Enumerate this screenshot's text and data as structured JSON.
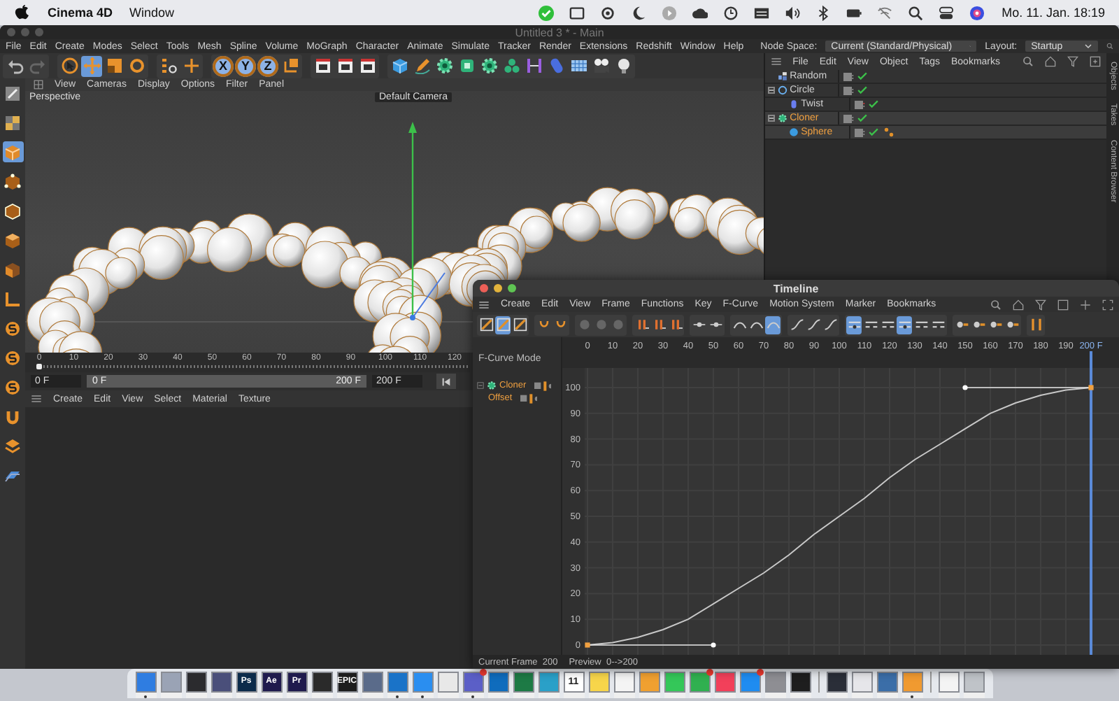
{
  "menubar": {
    "app": "Cinema 4D",
    "menus": [
      "Window"
    ],
    "clock": "Mo. 11. Jan. 18:19"
  },
  "window": {
    "title": "Untitled 3 * - Main",
    "menus": [
      "File",
      "Edit",
      "Create",
      "Modes",
      "Select",
      "Tools",
      "Mesh",
      "Spline",
      "Volume",
      "MoGraph",
      "Character",
      "Animate",
      "Simulate",
      "Tracker",
      "Render",
      "Extensions",
      "Redshift",
      "Window",
      "Help"
    ],
    "node_space": {
      "label": "Node Space:",
      "value": "Current (Standard/Physical)"
    },
    "layout": {
      "label": "Layout:",
      "value": "Startup"
    }
  },
  "toolbar": [
    [
      {
        "kind": "undo",
        "selected": false
      },
      {
        "kind": "redo",
        "selected": false
      }
    ],
    [
      {
        "kind": "select",
        "selected": false
      },
      {
        "kind": "move",
        "selected": true
      },
      {
        "kind": "scale",
        "selected": false
      },
      {
        "kind": "rotate",
        "selected": false
      }
    ],
    [
      {
        "kind": "recent",
        "selected": false
      },
      {
        "kind": "axis",
        "selected": false
      }
    ],
    [
      {
        "kind": "letter",
        "label": "X",
        "selected": true
      },
      {
        "kind": "letter",
        "label": "Y",
        "selected": true
      },
      {
        "kind": "letter",
        "label": "Z",
        "selected": true
      },
      {
        "kind": "coord",
        "selected": false
      }
    ],
    [
      {
        "kind": "clapper",
        "selected": false
      },
      {
        "kind": "clapper",
        "selected": false
      },
      {
        "kind": "clapper",
        "selected": false
      }
    ],
    [
      {
        "kind": "cube",
        "selected": false
      },
      {
        "kind": "pen",
        "selected": false
      },
      {
        "kind": "gear",
        "selected": false
      },
      {
        "kind": "greencube",
        "selected": false
      },
      {
        "kind": "gear",
        "selected": false
      },
      {
        "kind": "cluster",
        "selected": false
      },
      {
        "kind": "deformer",
        "selected": false
      },
      {
        "kind": "capsule",
        "selected": false
      },
      {
        "kind": "grid",
        "selected": false
      },
      {
        "kind": "camera",
        "selected": false
      },
      {
        "kind": "bulb",
        "selected": false
      }
    ]
  ],
  "tool_strip": [
    {
      "kind": "edit",
      "selected": false
    },
    {
      "kind": "checker",
      "selected": false
    },
    {
      "kind": "cube",
      "selected": true
    },
    {
      "kind": "points",
      "selected": false
    },
    {
      "kind": "edges",
      "selected": false
    },
    {
      "kind": "polygons",
      "selected": false
    },
    {
      "kind": "uv",
      "selected": false
    },
    {
      "kind": "axis",
      "selected": false
    },
    {
      "kind": "snap",
      "selected": false
    },
    {
      "kind": "snap",
      "selected": false
    },
    {
      "kind": "snap",
      "selected": false
    },
    {
      "kind": "magnet",
      "selected": false
    },
    {
      "kind": "layers",
      "selected": false
    },
    {
      "kind": "plane",
      "selected": false
    }
  ],
  "viewport": {
    "menus": [
      "View",
      "Cameras",
      "Display",
      "Options",
      "Filter",
      "Panel"
    ],
    "view_name": "Perspective",
    "camera": "Default Camera"
  },
  "powerslider": {
    "ticks": [
      "0",
      "10",
      "20",
      "30",
      "40",
      "50",
      "60",
      "70",
      "80",
      "90",
      "100",
      "110",
      "120"
    ],
    "start": "0 F",
    "range": {
      "start": "0 F",
      "end": "200 F",
      "level": 1
    },
    "end": "200 F"
  },
  "material_manager": {
    "menus": [
      "Create",
      "Edit",
      "View",
      "Select",
      "Material",
      "Texture"
    ]
  },
  "objects": {
    "menus": [
      "File",
      "Edit",
      "View",
      "Object",
      "Tags",
      "Bookmarks"
    ],
    "tree": [
      {
        "name": "Random",
        "kind": "effector",
        "selected": false,
        "disabled": false
      },
      {
        "name": "Circle",
        "kind": "spline",
        "selected": false,
        "expanded": true,
        "disabled": false,
        "children": [
          {
            "name": "Twist",
            "kind": "deformer",
            "selected": false,
            "disabled": true
          }
        ]
      },
      {
        "name": "Cloner",
        "kind": "cloner",
        "selected": true,
        "expanded": true,
        "disabled": false,
        "children": [
          {
            "name": "Sphere",
            "kind": "sphere",
            "selected": true,
            "disabled": false,
            "tags": [
              {
                "kind": "phong"
              }
            ]
          }
        ]
      }
    ],
    "side_tabs": [
      "Objects",
      "Takes",
      "Content Browser"
    ]
  },
  "timeline": {
    "title": "Timeline",
    "menus": [
      "Create",
      "Edit",
      "View",
      "Frame",
      "Functions",
      "Key",
      "F-Curve",
      "Motion System",
      "Marker",
      "Bookmarks"
    ],
    "toolbar": [
      [
        {
          "selected": false
        },
        {
          "selected": true
        },
        {
          "selected": false
        }
      ],
      [
        {
          "selected": false
        },
        {
          "selected": false
        }
      ],
      [
        {
          "selected": false
        },
        {
          "selected": false
        },
        {
          "selected": false
        }
      ],
      [
        {
          "selected": false
        },
        {
          "selected": false
        },
        {
          "selected": false
        }
      ],
      [
        {
          "selected": false
        },
        {
          "selected": false
        }
      ],
      [
        {
          "selected": false
        },
        {
          "selected": false
        },
        {
          "selected": true
        }
      ],
      [
        {
          "selected": false
        },
        {
          "selected": false
        },
        {
          "selected": false
        }
      ],
      [
        {
          "selected": true
        },
        {
          "selected": false
        },
        {
          "selected": false
        },
        {
          "selected": true
        },
        {
          "selected": false
        },
        {
          "selected": false
        }
      ],
      [
        {
          "selected": false
        },
        {
          "selected": false
        },
        {
          "selected": false
        },
        {
          "selected": false
        }
      ],
      [
        {
          "selected": false
        }
      ]
    ],
    "mode": "F-Curve Mode",
    "tracks": [
      {
        "name": "Cloner",
        "selected": true,
        "expanded": true,
        "children": [
          {
            "name": "Offset",
            "selected": true
          }
        ]
      }
    ],
    "chart_data": {
      "type": "line",
      "x": [
        0,
        10,
        20,
        30,
        40,
        50,
        60,
        70,
        80,
        90,
        100,
        110,
        120,
        130,
        140,
        150,
        160,
        170,
        180,
        190,
        200
      ],
      "series": [
        {
          "color": "#c8c8c8",
          "values": [
            0,
            1,
            3,
            6,
            10,
            16,
            22,
            28,
            35,
            43,
            50,
            57,
            65,
            72,
            78,
            84,
            90,
            94,
            97,
            99,
            100
          ]
        }
      ],
      "xlim": [
        0,
        200
      ],
      "ylim": [
        0,
        100
      ],
      "grid": true,
      "xticks": [
        0,
        10,
        20,
        30,
        40,
        50,
        60,
        70,
        80,
        90,
        100,
        110,
        120,
        130,
        140,
        150,
        160,
        170,
        180,
        190,
        {
          "value": 200,
          "label": "200 F"
        }
      ],
      "yticks": [
        0,
        10,
        20,
        30,
        40,
        50,
        60,
        70,
        80,
        90,
        100
      ]
    },
    "status": [
      "Current Frame  200",
      "Preview  0-->200"
    ]
  },
  "dock": {
    "apps": [
      {
        "kind": "app",
        "color": "#2f7de1",
        "running": true,
        "badge": false
      },
      {
        "kind": "app",
        "color": "#9aa3b5",
        "running": false,
        "badge": false
      },
      {
        "kind": "app",
        "color": "#2b2b2e",
        "running": false,
        "badge": false
      },
      {
        "kind": "app",
        "color": "#4a4f7a",
        "running": false,
        "badge": false
      },
      {
        "kind": "labeled",
        "label": "Ps",
        "color": "#0b2a4a",
        "running": false,
        "badge": false
      },
      {
        "kind": "labeled",
        "label": "Ae",
        "color": "#1f1a4d",
        "running": false,
        "badge": false
      },
      {
        "kind": "labeled",
        "label": "Pr",
        "color": "#1f1a4d",
        "running": false,
        "badge": false
      },
      {
        "kind": "app",
        "color": "#2a2a2a",
        "running": false,
        "badge": false
      },
      {
        "kind": "labeled",
        "label": "EPIC",
        "color": "#1d1d1d",
        "running": false,
        "badge": false
      },
      {
        "kind": "app",
        "color": "#5a6b8a",
        "running": false,
        "badge": false
      },
      {
        "kind": "app",
        "color": "#1a73c8",
        "running": true,
        "badge": false
      },
      {
        "kind": "app",
        "color": "#2a8ef0",
        "running": true,
        "badge": false
      },
      {
        "kind": "app",
        "color": "#e8e8e8",
        "running": false,
        "badge": false
      },
      {
        "kind": "app",
        "color": "#5b5fc7",
        "running": true,
        "badge": true
      },
      {
        "kind": "app",
        "color": "#0f6cbd",
        "running": false,
        "badge": false
      },
      {
        "kind": "app",
        "color": "#1d7a45",
        "running": false,
        "badge": false
      },
      {
        "kind": "app",
        "color": "#2aa0c8",
        "running": false,
        "badge": false
      },
      {
        "kind": "calendar",
        "label": "11",
        "color": "#ffffff",
        "running": false,
        "badge": false
      },
      {
        "kind": "app",
        "color": "#f7d54a",
        "running": false,
        "badge": false
      },
      {
        "kind": "app",
        "color": "#f4f4f4",
        "running": false,
        "badge": false
      },
      {
        "kind": "app",
        "color": "#f0a030",
        "running": false,
        "badge": false
      },
      {
        "kind": "app",
        "color": "#34c759",
        "running": false,
        "badge": false
      },
      {
        "kind": "app",
        "color": "#30b050",
        "running": false,
        "badge": true
      },
      {
        "kind": "app",
        "color": "#f2405a",
        "running": false,
        "badge": false
      },
      {
        "kind": "app",
        "color": "#1f8cf0",
        "running": false,
        "badge": true
      },
      {
        "kind": "app",
        "color": "#8e8e93",
        "running": false,
        "badge": false
      },
      {
        "kind": "app",
        "color": "#1e1e1e",
        "running": false,
        "badge": false
      },
      {
        "kind": "separator"
      },
      {
        "kind": "app",
        "color": "#2a2e38",
        "running": false,
        "badge": false
      },
      {
        "kind": "app",
        "color": "#e6e6ea",
        "running": false,
        "badge": false
      },
      {
        "kind": "app",
        "color": "#3b6ea8",
        "running": false,
        "badge": false
      },
      {
        "kind": "app",
        "color": "#f09a30",
        "running": true,
        "badge": false
      },
      {
        "kind": "separator"
      },
      {
        "kind": "app",
        "color": "#f4f4f4",
        "running": false,
        "badge": false
      },
      {
        "kind": "app",
        "color": "#bfc3c8",
        "running": false,
        "badge": false
      }
    ]
  }
}
